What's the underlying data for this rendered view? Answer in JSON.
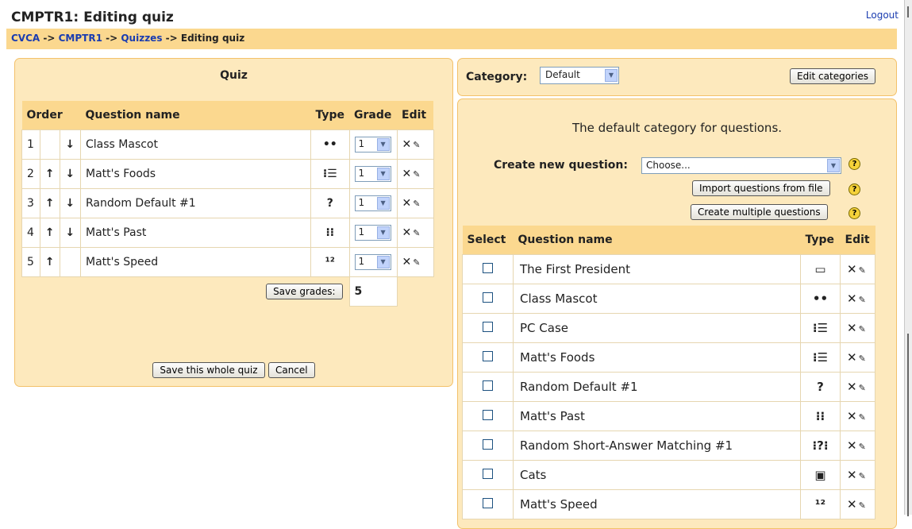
{
  "header": {
    "title": "CMPTR1: Editing quiz",
    "logout": "Logout"
  },
  "breadcrumb": {
    "items": [
      "CVCA",
      "CMPTR1",
      "Quizzes"
    ],
    "separator": "->",
    "current": "Editing quiz"
  },
  "quiz": {
    "heading": "Quiz",
    "columns": {
      "order": "Order",
      "name": "Question name",
      "type": "Type",
      "grade": "Grade",
      "edit": "Edit"
    },
    "rows": [
      {
        "num": "1",
        "up": "",
        "down": "↓",
        "name": "Class Mascot",
        "type_icon": "••",
        "grade": "1"
      },
      {
        "num": "2",
        "up": "↑",
        "down": "↓",
        "name": "Matt's Foods",
        "type_icon": "⁝☰",
        "grade": "1"
      },
      {
        "num": "3",
        "up": "↑",
        "down": "↓",
        "name": "Random Default #1",
        "type_icon": "?",
        "grade": "1"
      },
      {
        "num": "4",
        "up": "↑",
        "down": "↓",
        "name": "Matt's Past",
        "type_icon": "⁝⁝",
        "grade": "1"
      },
      {
        "num": "5",
        "up": "↑",
        "down": "",
        "name": "Matt's Speed",
        "type_icon": "¹²",
        "grade": "1"
      }
    ],
    "save_grades_label": "Save grades:",
    "total_grade": "5",
    "save_quiz_label": "Save this whole quiz",
    "cancel_label": "Cancel"
  },
  "category": {
    "label": "Category:",
    "selected": "Default",
    "edit_label": "Edit categories"
  },
  "bank": {
    "description": "The default category for questions.",
    "create_label": "Create new question:",
    "create_selected": "Choose...",
    "import_label": "Import questions from file",
    "multiple_label": "Create multiple questions",
    "help_glyph": "?",
    "columns": {
      "select": "Select",
      "name": "Question name",
      "type": "Type",
      "edit": "Edit"
    },
    "rows": [
      {
        "name": "The First President",
        "type_icon": "▭"
      },
      {
        "name": "Class Mascot",
        "type_icon": "••"
      },
      {
        "name": "PC Case",
        "type_icon": "⁝☰"
      },
      {
        "name": "Matt's Foods",
        "type_icon": "⁝☰"
      },
      {
        "name": "Random Default #1",
        "type_icon": "?"
      },
      {
        "name": "Matt's Past",
        "type_icon": "⁝⁝"
      },
      {
        "name": "Random Short-Answer Matching #1",
        "type_icon": "⁝?⁝"
      },
      {
        "name": "Cats",
        "type_icon": "▣"
      },
      {
        "name": "Matt's Speed",
        "type_icon": "¹²"
      }
    ]
  },
  "icons": {
    "delete": "✕",
    "edit": "✎"
  }
}
